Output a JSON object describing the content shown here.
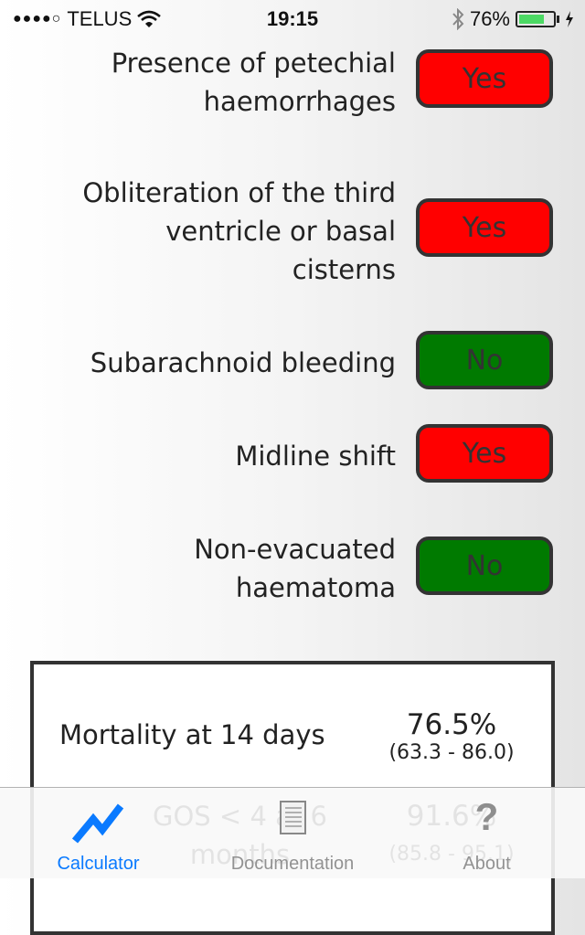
{
  "status_bar": {
    "signal": "●●●●○",
    "carrier": "TELUS",
    "time": "19:15",
    "battery_percent": "76%",
    "battery_level": 0.76
  },
  "criteria": [
    {
      "label_lines": [
        "Presence of petechial",
        "haemorrhages"
      ],
      "value": "Yes",
      "state": "yes"
    },
    {
      "label_lines": [
        "Obliteration of the third",
        "ventricle or basal",
        "cisterns"
      ],
      "value": "Yes",
      "state": "yes"
    },
    {
      "label_lines": [
        "Subarachnoid bleeding"
      ],
      "value": "No",
      "state": "no"
    },
    {
      "label_lines": [
        "Midline shift"
      ],
      "value": "Yes",
      "state": "yes"
    },
    {
      "label_lines": [
        "Non-evacuated",
        "haematoma"
      ],
      "value": "No",
      "state": "no"
    }
  ],
  "results": [
    {
      "label": "Mortality at 14 days",
      "value": "76.5%",
      "ci": "(63.3 - 86.0)"
    },
    {
      "label_lines": [
        "GOS < 4 at 6",
        "months"
      ],
      "value": "91.6%",
      "ci": "(85.8 - 95.1)"
    }
  ],
  "colors": {
    "yes": "#ff0000",
    "no": "#007a00",
    "accent": "#0a7aff"
  },
  "tabs": [
    {
      "label": "Calculator",
      "icon": "chart-line-icon",
      "active": true
    },
    {
      "label": "Documentation",
      "icon": "notebook-icon",
      "active": false
    },
    {
      "label": "About",
      "icon": "question-mark-icon",
      "active": false
    }
  ]
}
